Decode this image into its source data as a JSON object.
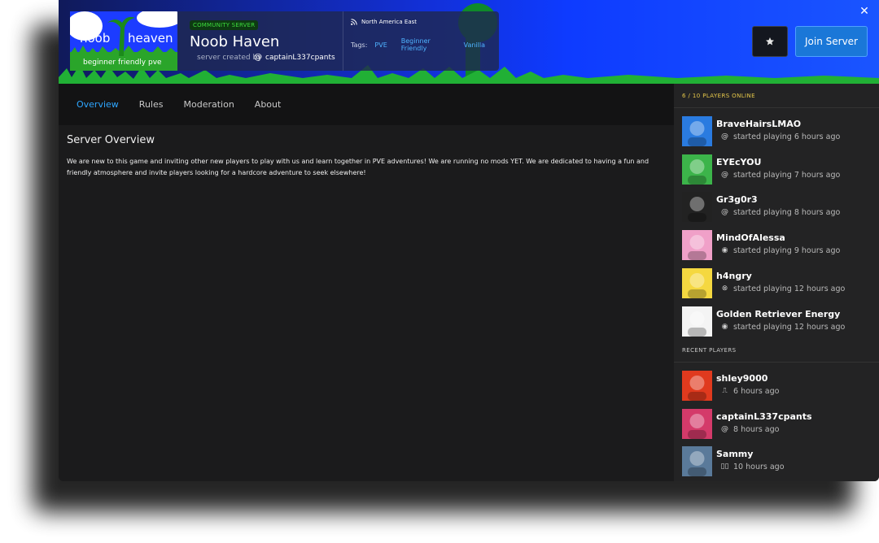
{
  "header": {
    "logo": {
      "line1a": "noob",
      "line1b": "heaven",
      "line2": "beginner friendly pve"
    },
    "badge": "COMMUNITY SERVER",
    "title": "Noob Haven",
    "created_by_label": "server created by",
    "creator": "captainL337cpants",
    "region": "North America East",
    "tags_label": "Tags:",
    "tags": [
      "PVE",
      "Beginner Friendly",
      "Vanilla"
    ],
    "join_label": "Join Server",
    "close_icon": "close-icon",
    "favorite_icon": "star-icon"
  },
  "tabs": [
    "Overview",
    "Rules",
    "Moderation",
    "About"
  ],
  "active_tab": "Overview",
  "overview": {
    "title": "Server Overview",
    "text": "We are new to this game and inviting other new players to play with us and learn together in PVE adventures! We are running no mods YET. We are dedicated to having a fun and friendly atmosphere and invite players looking for a hardcore adventure to seek elsewhere!"
  },
  "online": {
    "count": "6 / 10",
    "label": "PLAYERS ONLINE",
    "players": [
      {
        "name": "BraveHairsLMAO",
        "status": "started playing 6 hours ago",
        "platform": "at-icon",
        "color": "#2a7be0"
      },
      {
        "name": "EYEcYOU",
        "status": "started playing 7 hours ago",
        "platform": "at-icon",
        "color": "#3cb44a"
      },
      {
        "name": "Gr3g0r3",
        "status": "started playing 8 hours ago",
        "platform": "at-icon",
        "color": "#222222"
      },
      {
        "name": "MindOfAlessa",
        "status": "started playing 9 hours ago",
        "platform": "steam-icon",
        "color": "#f0a0c8"
      },
      {
        "name": "h4ngry",
        "status": "started playing 12 hours ago",
        "platform": "xbox-icon",
        "color": "#f5d840"
      },
      {
        "name": "Golden Retriever Energy",
        "status": "started playing 12 hours ago",
        "platform": "steam-icon",
        "color": "#f4f4f4"
      }
    ]
  },
  "recent": {
    "label": "RECENT PLAYERS",
    "players": [
      {
        "name": "shley9000",
        "status": "6 hours ago",
        "platform": "playstation-icon",
        "color": "#e03a1e"
      },
      {
        "name": "captainL337cpants",
        "status": "8 hours ago",
        "platform": "at-icon",
        "color": "#d43a6a"
      },
      {
        "name": "Sammy",
        "status": "10 hours ago",
        "platform": "switch-icon",
        "color": "#5a7a9a"
      }
    ]
  }
}
